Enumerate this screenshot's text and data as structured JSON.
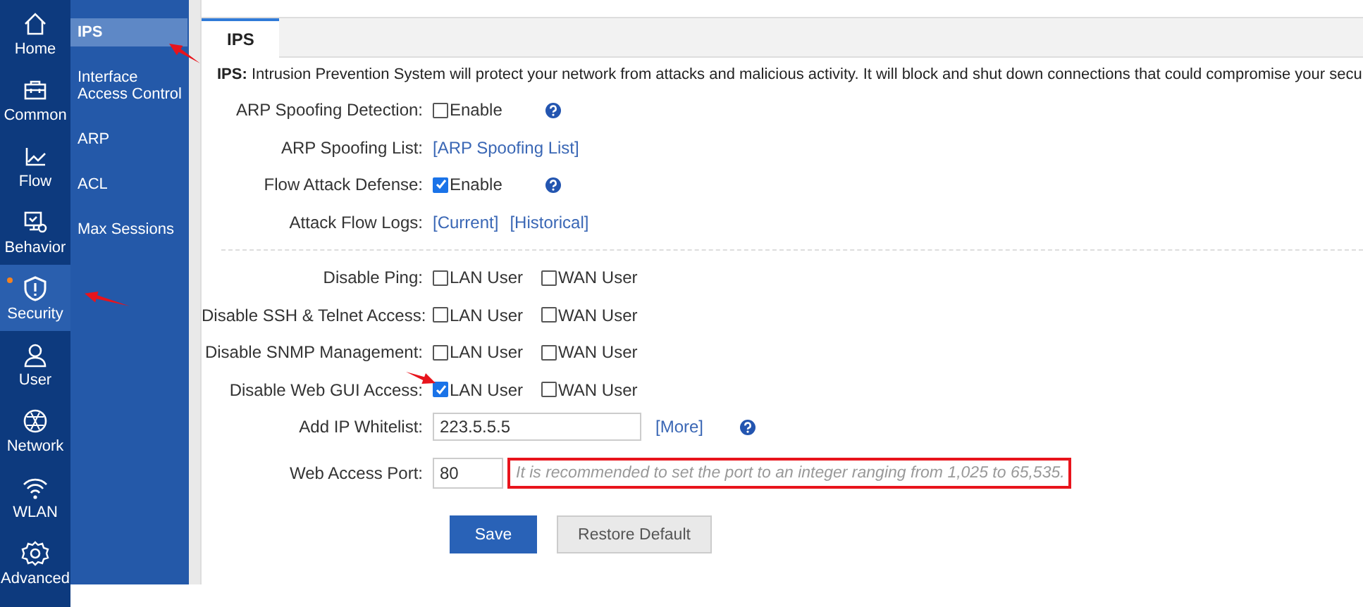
{
  "nav": {
    "items": [
      {
        "label": "Home",
        "selected": false,
        "dot": false,
        "arrow": false
      },
      {
        "label": "Common",
        "selected": false,
        "dot": false,
        "arrow": false
      },
      {
        "label": "Flow",
        "selected": false,
        "dot": false,
        "arrow": false
      },
      {
        "label": "Behavior",
        "selected": false,
        "dot": false,
        "arrow": false
      },
      {
        "label": "Security",
        "selected": true,
        "dot": true,
        "arrow": true
      },
      {
        "label": "User",
        "selected": false,
        "dot": false,
        "arrow": false
      },
      {
        "label": "Network",
        "selected": false,
        "dot": false,
        "arrow": false
      },
      {
        "label": "WLAN",
        "selected": false,
        "dot": false,
        "arrow": false
      },
      {
        "label": "Advanced",
        "selected": false,
        "dot": false,
        "arrow": false
      }
    ]
  },
  "submenu": {
    "items": [
      {
        "label": "IPS",
        "selected": true,
        "arrow": true
      },
      {
        "label": "Interface Access Control",
        "selected": false,
        "arrow": false
      },
      {
        "label": "ARP",
        "selected": false,
        "arrow": false
      },
      {
        "label": "ACL",
        "selected": false,
        "arrow": false
      },
      {
        "label": "Max Sessions",
        "selected": false,
        "arrow": false
      }
    ]
  },
  "tabs": [
    {
      "label": "IPS",
      "selected": true
    }
  ],
  "description": "**IPS:**  Intrusion Prevention System will protect your network from attacks and malicious activity. It will block and shut down connections that could compromise your secu",
  "sections": [
    {
      "rows": [
        {
          "kind": "checkbox",
          "label": "ARP Spoofing Detection:",
          "options": [
            {
              "label": "Enable",
              "checked": false
            }
          ],
          "help": true,
          "arrow": false
        },
        {
          "kind": "links",
          "label": "ARP Spoofing List:",
          "links": [
            "[ARP Spoofing List]"
          ],
          "arrow": false
        },
        {
          "kind": "checkbox",
          "label": "Flow Attack Defense:",
          "options": [
            {
              "label": "Enable",
              "checked": true
            }
          ],
          "help": true,
          "arrow": false
        },
        {
          "kind": "links",
          "label": "Attack Flow Logs:",
          "links": [
            "[Current]",
            "[Historical]"
          ],
          "arrow": false
        }
      ]
    },
    {
      "rows": [
        {
          "kind": "checkbox",
          "label": "Disable Ping:",
          "options": [
            {
              "label": "LAN User",
              "checked": false
            },
            {
              "label": "WAN User",
              "checked": false
            }
          ],
          "help": false,
          "arrow": false
        },
        {
          "kind": "checkbox",
          "label": "Disable SSH & Telnet Access:",
          "options": [
            {
              "label": "LAN User",
              "checked": false
            },
            {
              "label": "WAN User",
              "checked": false
            }
          ],
          "help": false,
          "arrow": false
        },
        {
          "kind": "checkbox",
          "label": "Disable SNMP Management:",
          "options": [
            {
              "label": "LAN User",
              "checked": false
            },
            {
              "label": "WAN User",
              "checked": false
            }
          ],
          "help": false,
          "arrow": false
        },
        {
          "kind": "checkbox",
          "label": "Disable Web GUI Access:",
          "options": [
            {
              "label": "LAN User",
              "checked": true
            },
            {
              "label": "WAN User",
              "checked": false
            }
          ],
          "help": false,
          "arrow": true
        },
        {
          "kind": "input",
          "label": "Add IP Whitelist:",
          "value": "223.5.5.5",
          "link": "[More]",
          "help": true,
          "arrow": false
        },
        {
          "kind": "port",
          "label": "Web Access Port:",
          "value": "80",
          "hint": "It is recommended to set the port to an integer ranging from 1,025 to 65,535.",
          "highlighted": true,
          "arrow": false
        }
      ]
    }
  ],
  "buttons": [
    {
      "label": "Save",
      "kind": "primary"
    },
    {
      "label": "Restore Default",
      "kind": "secondary"
    }
  ]
}
